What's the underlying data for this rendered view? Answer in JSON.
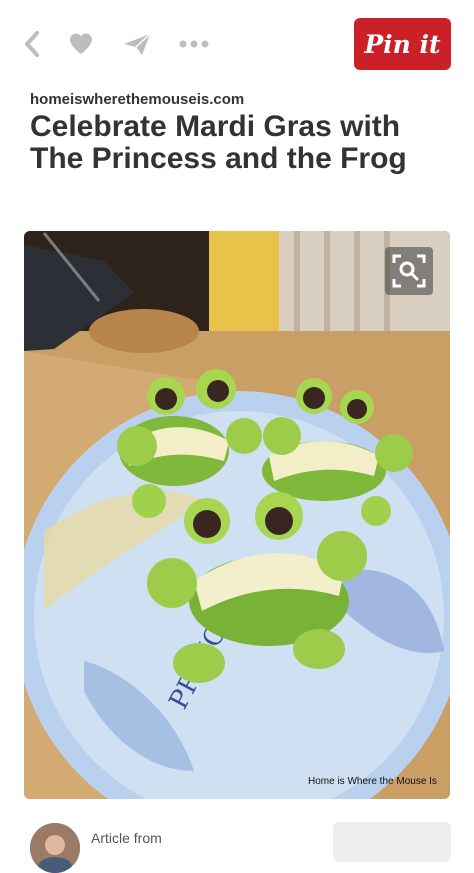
{
  "toolbar": {
    "back_icon": "chevron-left-icon",
    "like_icon": "heart-icon",
    "send_icon": "paper-plane-icon",
    "more_icon": "ellipsis-icon",
    "pin_label": "Pin it",
    "pin_color": "#cb2027"
  },
  "pin": {
    "source": "homeiswherethemouseis.com",
    "title": "Celebrate Mardi Gras with The Princess and the Frog",
    "image": {
      "description_icon": "photo-frog-apple-snack",
      "watermark": "Home is Where the Mouse Is",
      "zoom_icon": "visual-search-icon"
    }
  },
  "footer": {
    "article_label": "Article from"
  },
  "colors": {
    "title_text": "#333333",
    "background": "#ffffff"
  }
}
